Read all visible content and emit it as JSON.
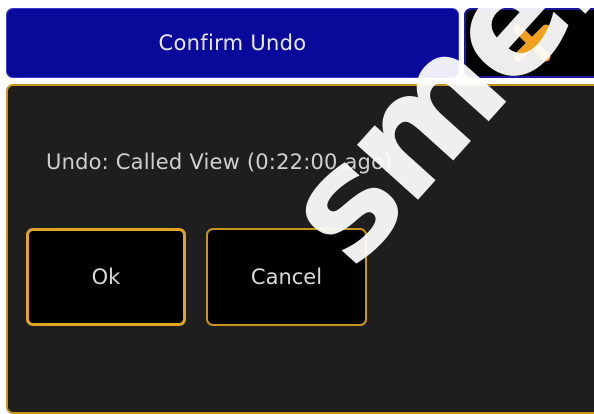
{
  "dialog": {
    "title": "Confirm Undo",
    "message": "Undo: Called View (0:22:00 ago)",
    "ok_label": "Ok",
    "cancel_label": "Cancel",
    "close_icon": "close-x-icon"
  },
  "watermark": {
    "text": "smend"
  },
  "colors": {
    "title_bar": "#0a0a9a",
    "panel_bg": "#1e1e1e",
    "accent_border": "#c89420",
    "close_icon": "#f0a020"
  }
}
